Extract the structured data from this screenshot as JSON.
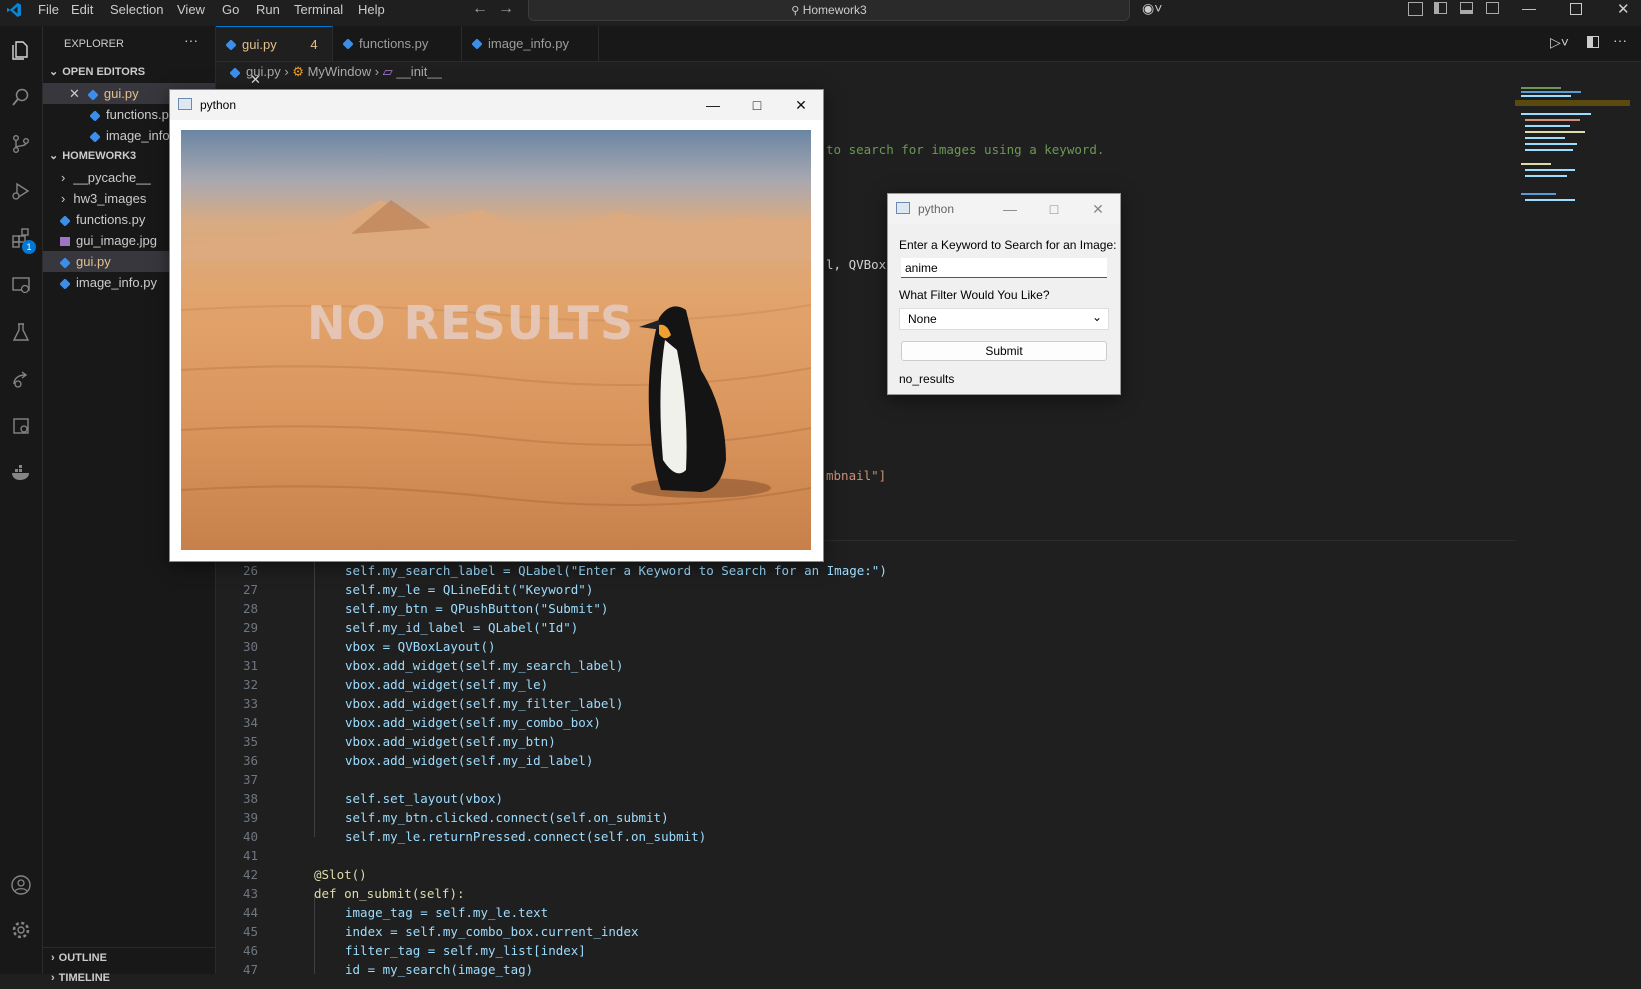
{
  "menu": [
    "File",
    "Edit",
    "Selection",
    "View",
    "Go",
    "Run",
    "Terminal",
    "Help"
  ],
  "command_center": "Homework3",
  "sidebar": {
    "title": "EXPLORER",
    "open_editors_label": "OPEN EDITORS",
    "open_editors": [
      "gui.py",
      "functions.py",
      "image_info.py"
    ],
    "project_label": "HOMEWORK3",
    "files": [
      "__pycache__",
      "hw3_images",
      "functions.py",
      "gui_image.jpg",
      "gui.py",
      "image_info.py"
    ],
    "outline_label": "OUTLINE",
    "timeline_label": "TIMELINE"
  },
  "tabs": [
    {
      "label": "gui.py",
      "badge": "4"
    },
    {
      "label": "functions.py"
    },
    {
      "label": "image_info.py"
    }
  ],
  "breadcrumb": [
    "gui.py",
    "MyWindow",
    "__init__"
  ],
  "activity_badge": "1",
  "code_partial": {
    "line_a": "to search for images using a keyword.",
    "line_b": "l, QVBoxL",
    "line_c": "mbnail\"]"
  },
  "code_lines": [
    {
      "n": "26",
      "t": "self.my_search_label = QLabel(\"Enter a Keyword to Search for an Image:\")"
    },
    {
      "n": "27",
      "t": "self.my_le = QLineEdit(\"Keyword\")"
    },
    {
      "n": "28",
      "t": "self.my_btn = QPushButton(\"Submit\")"
    },
    {
      "n": "29",
      "t": "self.my_id_label = QLabel(\"Id\")"
    },
    {
      "n": "30",
      "t": "vbox = QVBoxLayout()"
    },
    {
      "n": "31",
      "t": "vbox.add_widget(self.my_search_label)"
    },
    {
      "n": "32",
      "t": "vbox.add_widget(self.my_le)"
    },
    {
      "n": "33",
      "t": "vbox.add_widget(self.my_filter_label)"
    },
    {
      "n": "34",
      "t": "vbox.add_widget(self.my_combo_box)"
    },
    {
      "n": "35",
      "t": "vbox.add_widget(self.my_btn)"
    },
    {
      "n": "36",
      "t": "vbox.add_widget(self.my_id_label)"
    },
    {
      "n": "37",
      "t": ""
    },
    {
      "n": "38",
      "t": "self.set_layout(vbox)"
    },
    {
      "n": "39",
      "t": "self.my_btn.clicked.connect(self.on_submit)"
    },
    {
      "n": "40",
      "t": "self.my_le.returnPressed.connect(self.on_submit)"
    },
    {
      "n": "41",
      "t": ""
    },
    {
      "n": "42",
      "t": "@Slot()"
    },
    {
      "n": "43",
      "t": "def on_submit(self):"
    },
    {
      "n": "44",
      "t": "image_tag = self.my_le.text"
    },
    {
      "n": "45",
      "t": "index = self.my_combo_box.current_index"
    },
    {
      "n": "46",
      "t": "filter_tag = self.my_list[index]"
    },
    {
      "n": "47",
      "t": "id = my_search(image_tag)"
    }
  ],
  "image_window": {
    "title": "python",
    "image_text": "NO RESULTS"
  },
  "search_window": {
    "title": "python",
    "keyword_label": "Enter a Keyword to Search for an Image:",
    "keyword_value": "anime",
    "filter_label": "What Filter Would You Like?",
    "filter_value": "None",
    "submit_label": "Submit",
    "result_label": "no_results"
  },
  "colors": {
    "accent": "#0078d4",
    "modified": "#e2c08d",
    "python": "#3b8eea"
  }
}
